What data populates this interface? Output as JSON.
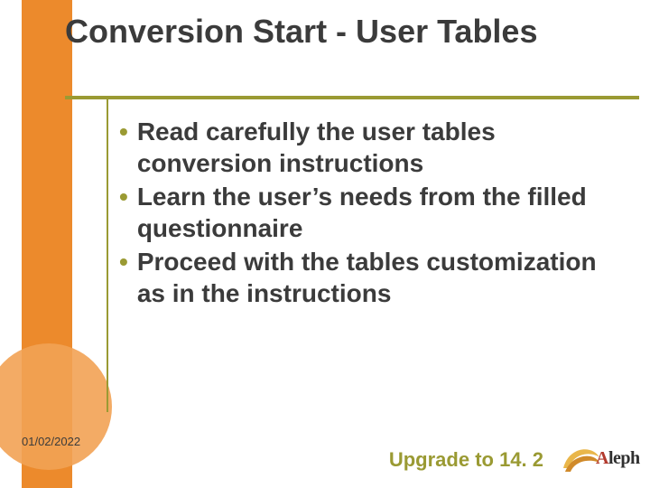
{
  "title": "Conversion Start - User Tables",
  "bullets": [
    "Read carefully the user tables conversion instructions",
    "Learn the user’s needs from the filled questionnaire",
    "Proceed with the tables customization as in the instructions"
  ],
  "footer": {
    "date": "01/02/2022",
    "caption": "Upgrade to 14. 2"
  },
  "logo": {
    "name": "Aleph",
    "icon": "swoosh-icon"
  },
  "colors": {
    "accent_orange": "#ec8a2c",
    "accent_olive": "#9a9a33",
    "text": "#3b3b3b"
  }
}
